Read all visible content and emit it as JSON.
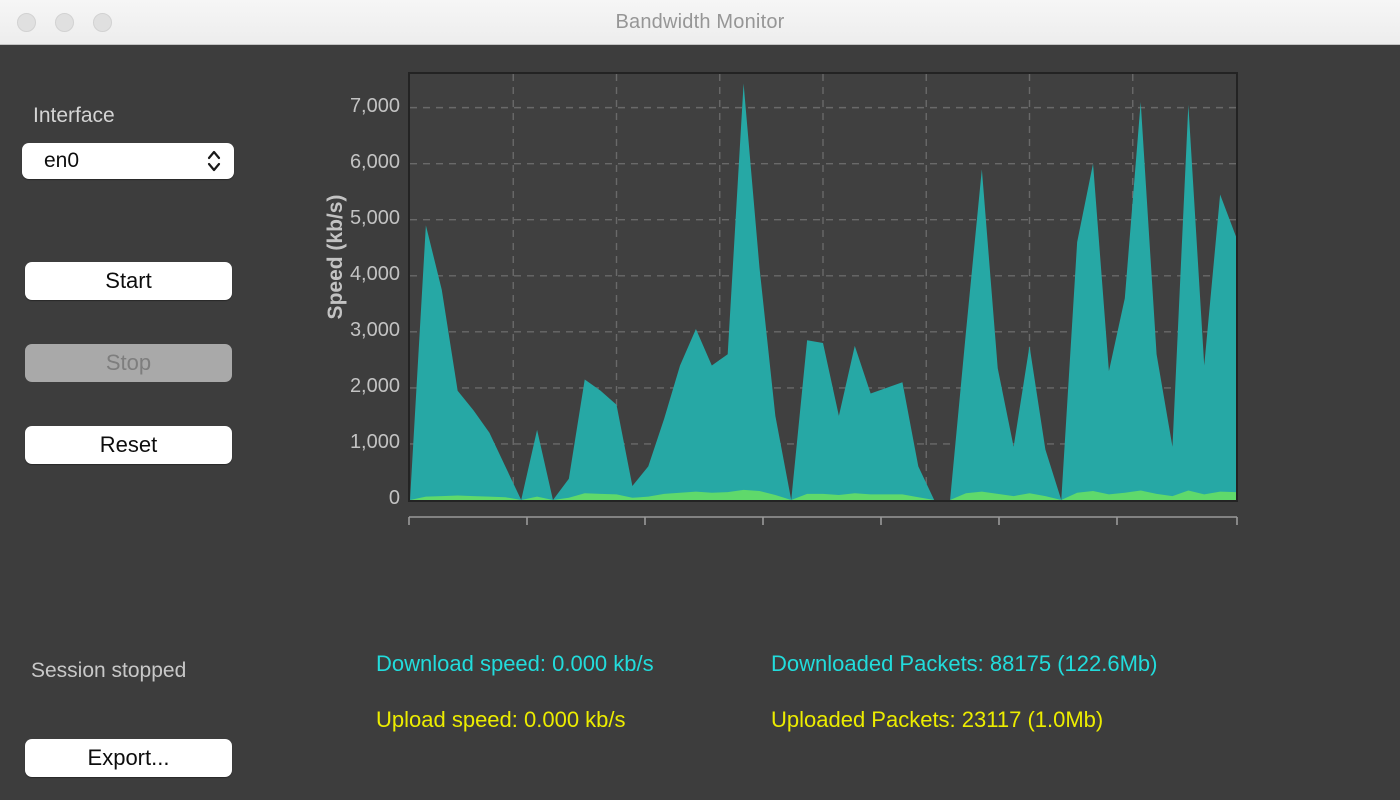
{
  "window": {
    "title": "Bandwidth Monitor",
    "traffic_lights": [
      "close",
      "minimize",
      "zoom"
    ]
  },
  "sidebar": {
    "interface_label": "Interface",
    "interface_value": "en0",
    "interface_options": [
      "en0"
    ],
    "buttons": [
      {
        "name": "start",
        "label": "Start",
        "enabled": true
      },
      {
        "name": "stop",
        "label": "Stop",
        "enabled": false
      },
      {
        "name": "reset",
        "label": "Reset",
        "enabled": true
      }
    ],
    "session_status": "Session stopped",
    "export_label": "Export..."
  },
  "stats": {
    "download_speed": "Download speed: 0.000 kb/s",
    "downloaded_packets": "Downloaded Packets: 88175 (122.6Mb)",
    "upload_speed": "Upload speed: 0.000 kb/s",
    "uploaded_packets": "Uploaded Packets: 23117 (1.0Mb)",
    "download_color": "#22dcdc",
    "upload_color": "#ecec00"
  },
  "chart_data": {
    "type": "area",
    "title": "",
    "xlabel": "",
    "ylabel": "Speed (kb/s)",
    "ylim": [
      0,
      7600
    ],
    "yticks": [
      0,
      1000,
      2000,
      3000,
      4000,
      5000,
      6000,
      7000
    ],
    "ytick_labels": [
      "0",
      "1,000",
      "2,000",
      "3,000",
      "4,000",
      "5,000",
      "6,000",
      "7,000"
    ],
    "grid": true,
    "grid_style": "dashed",
    "grid_color": "#8c8c8c",
    "plot_bg": "#404040",
    "legend_position": "none",
    "x_tick_count": 8,
    "x_tick_labels": [],
    "series": [
      {
        "name": "Download",
        "color": "#26a8a5",
        "values": [
          0,
          4900,
          3750,
          1950,
          1600,
          1200,
          600,
          0,
          1250,
          0,
          380,
          2150,
          1950,
          1700,
          250,
          600,
          1450,
          2400,
          3050,
          2400,
          2600,
          7430,
          4150,
          1500,
          0,
          2850,
          2800,
          1500,
          2750,
          1900,
          2000,
          2100,
          600,
          0,
          0,
          3000,
          5900,
          2350,
          950,
          2750,
          900,
          0,
          4600,
          6000,
          2300,
          3600,
          7100,
          2600,
          950,
          7050,
          2400,
          5450,
          4700
        ]
      },
      {
        "name": "Upload",
        "color": "#5fd96b",
        "values": [
          0,
          60,
          70,
          80,
          70,
          60,
          50,
          0,
          60,
          0,
          40,
          120,
          110,
          100,
          40,
          60,
          110,
          130,
          150,
          130,
          140,
          180,
          160,
          90,
          0,
          110,
          110,
          90,
          120,
          100,
          100,
          100,
          50,
          0,
          0,
          120,
          150,
          110,
          70,
          120,
          70,
          0,
          130,
          160,
          100,
          130,
          170,
          110,
          70,
          170,
          100,
          150,
          140
        ]
      }
    ]
  }
}
